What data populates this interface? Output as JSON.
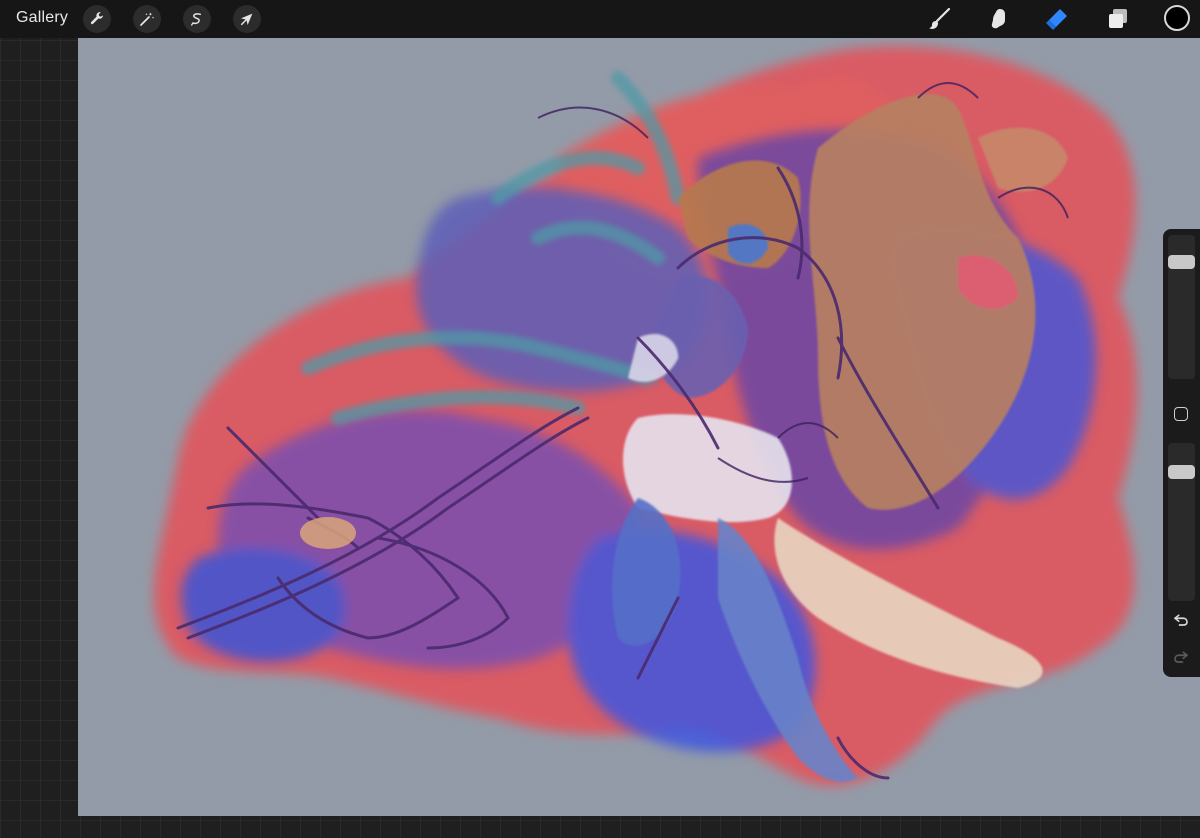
{
  "toolbar": {
    "gallery_label": "Gallery",
    "left_tools": [
      {
        "icon": "wrench-icon",
        "name": "actions"
      },
      {
        "icon": "magic-wand-icon",
        "name": "adjustments"
      },
      {
        "icon": "selection-icon",
        "name": "selection"
      },
      {
        "icon": "arrow-cursor-icon",
        "name": "transform"
      }
    ],
    "right_tools": [
      {
        "icon": "brush-icon",
        "name": "brush",
        "active": false
      },
      {
        "icon": "smudge-icon",
        "name": "smudge",
        "active": false
      },
      {
        "icon": "eraser-icon",
        "name": "eraser",
        "active": true
      },
      {
        "icon": "layers-icon",
        "name": "layers",
        "active": false
      }
    ],
    "current_color": "#000000"
  },
  "sidebar": {
    "brush_size": 0.15,
    "opacity": 0.15
  },
  "colors": {
    "canvas_bg": "#939ba8",
    "accent": "#2f86ff",
    "toolbar_bg": "#161616"
  }
}
